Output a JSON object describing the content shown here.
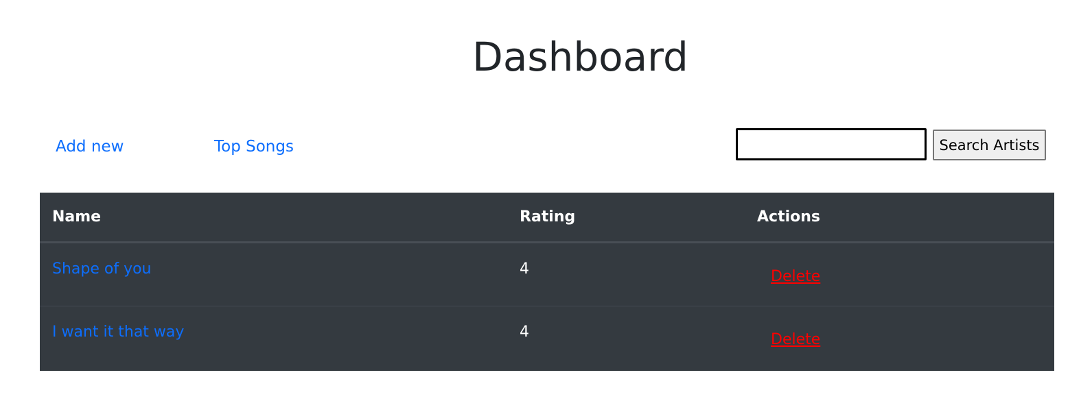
{
  "page": {
    "title": "Dashboard"
  },
  "nav": {
    "add_new": "Add new",
    "top_songs": "Top Songs"
  },
  "search": {
    "value": "",
    "placeholder": "",
    "button_label": "Search Artists"
  },
  "table": {
    "headers": {
      "name": "Name",
      "rating": "Rating",
      "actions": "Actions"
    },
    "rows": [
      {
        "name": "Shape of you",
        "rating": "4",
        "action": "Delete"
      },
      {
        "name": "I want it that way",
        "rating": "4",
        "action": "Delete"
      }
    ]
  },
  "colors": {
    "link": "#0d6efd",
    "table_bg": "#343a40",
    "delete": "#ff0000",
    "title": "#212529"
  }
}
